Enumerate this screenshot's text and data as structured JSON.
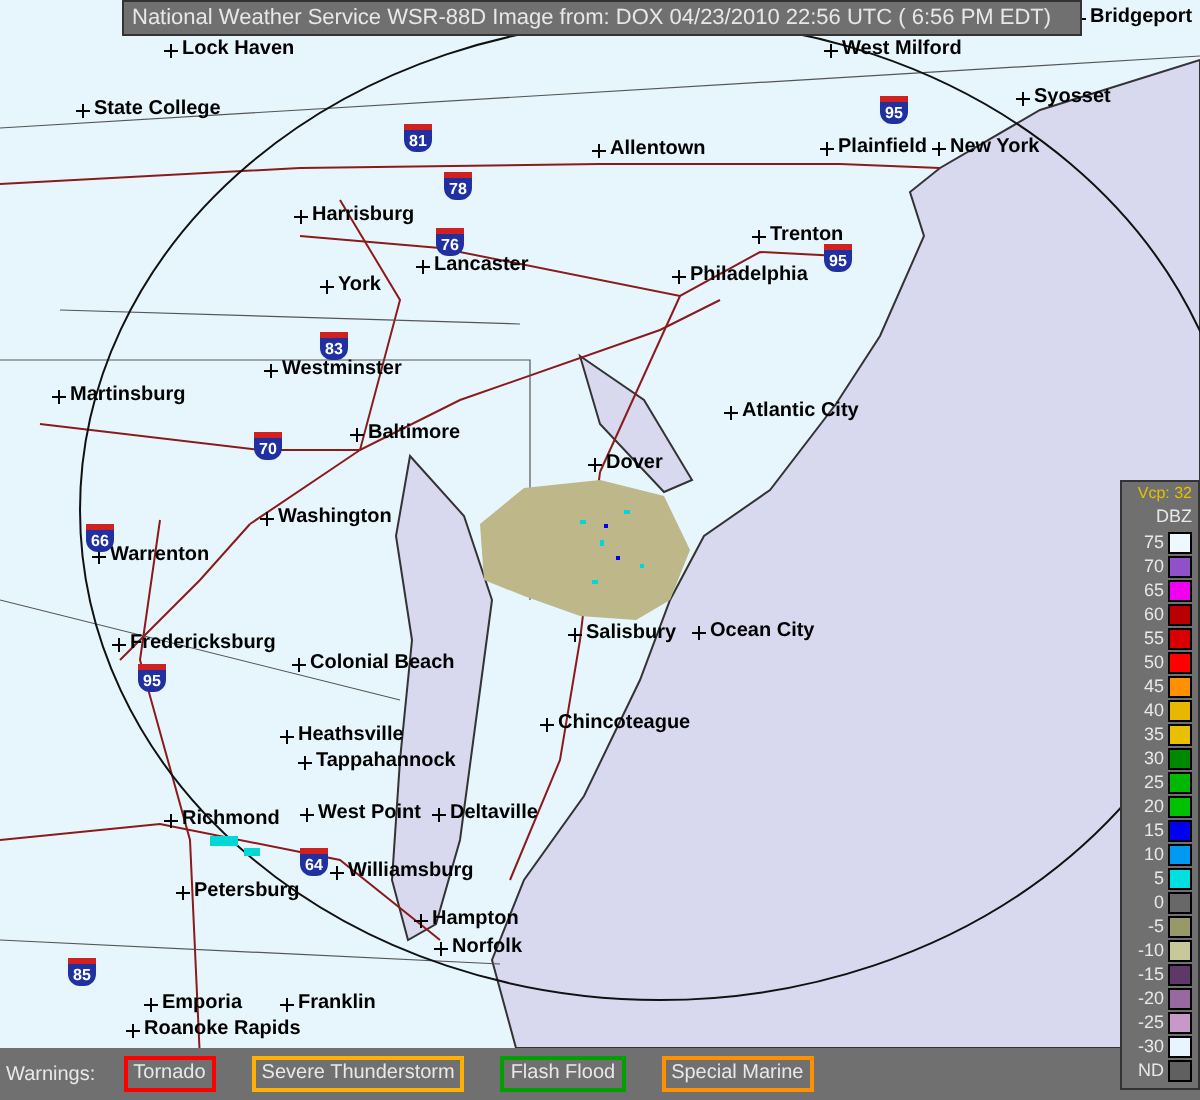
{
  "header": {
    "title": "National Weather Service WSR-88D Image from: DOX 04/23/2010 22:56 UTC ( 6:56 PM EDT)"
  },
  "map": {
    "cities": [
      {
        "name": "Lock Haven"
      },
      {
        "name": "West Milford"
      },
      {
        "name": "Bridgeport"
      },
      {
        "name": "State College"
      },
      {
        "name": "Syosset"
      },
      {
        "name": "Allentown"
      },
      {
        "name": "Plainfield"
      },
      {
        "name": "New York"
      },
      {
        "name": "Harrisburg"
      },
      {
        "name": "Trenton"
      },
      {
        "name": "York"
      },
      {
        "name": "Lancaster"
      },
      {
        "name": "Philadelphia"
      },
      {
        "name": "Martinsburg"
      },
      {
        "name": "Westminster"
      },
      {
        "name": "Atlantic City"
      },
      {
        "name": "Baltimore"
      },
      {
        "name": "Dover"
      },
      {
        "name": "Washington"
      },
      {
        "name": "Warrenton"
      },
      {
        "name": "Fredericksburg"
      },
      {
        "name": "Colonial Beach"
      },
      {
        "name": "Salisbury"
      },
      {
        "name": "Ocean City"
      },
      {
        "name": "Chincoteague"
      },
      {
        "name": "Heathsville"
      },
      {
        "name": "Tappahannock"
      },
      {
        "name": "Richmond"
      },
      {
        "name": "West Point"
      },
      {
        "name": "Deltaville"
      },
      {
        "name": "Williamsburg"
      },
      {
        "name": "Petersburg"
      },
      {
        "name": "Hampton"
      },
      {
        "name": "Norfolk"
      },
      {
        "name": "Emporia"
      },
      {
        "name": "Franklin"
      },
      {
        "name": "Roanoke Rapids"
      }
    ],
    "shields": [
      {
        "number": "81"
      },
      {
        "number": "95"
      },
      {
        "number": "78"
      },
      {
        "number": "76"
      },
      {
        "number": "95"
      },
      {
        "number": "83"
      },
      {
        "number": "70"
      },
      {
        "number": "66"
      },
      {
        "number": "95"
      },
      {
        "number": "64"
      },
      {
        "number": "85"
      }
    ]
  },
  "legend": {
    "vcp": "Vcp: 32",
    "unit": "DBZ",
    "levels": [
      {
        "label": "75",
        "color": "#eef8ff"
      },
      {
        "label": "70",
        "color": "#9050c8"
      },
      {
        "label": "65",
        "color": "#f000f0"
      },
      {
        "label": "60",
        "color": "#b80000"
      },
      {
        "label": "55",
        "color": "#d80000"
      },
      {
        "label": "50",
        "color": "#ff0000"
      },
      {
        "label": "45",
        "color": "#ff9000"
      },
      {
        "label": "40",
        "color": "#e8b800"
      },
      {
        "label": "35",
        "color": "#e8c000"
      },
      {
        "label": "30",
        "color": "#008800"
      },
      {
        "label": "25",
        "color": "#00b800"
      },
      {
        "label": "20",
        "color": "#00c000"
      },
      {
        "label": "15",
        "color": "#0000f0"
      },
      {
        "label": "10",
        "color": "#0098f0"
      },
      {
        "label": "5",
        "color": "#00e0e0"
      },
      {
        "label": "0",
        "color": "#686868"
      },
      {
        "label": "-5",
        "color": "#989868"
      },
      {
        "label": "-10",
        "color": "#c8c898"
      },
      {
        "label": "-15",
        "color": "#603868"
      },
      {
        "label": "-20",
        "color": "#9868a0"
      },
      {
        "label": "-25",
        "color": "#c898c8"
      },
      {
        "label": "-30",
        "color": "#e8f4ff"
      },
      {
        "label": "ND",
        "color": "#606060"
      }
    ]
  },
  "warnings": {
    "label": "Warnings:",
    "items": [
      {
        "label": "Tornado",
        "color": "#ff0000"
      },
      {
        "label": "Severe Thunderstorm",
        "color": "#ffb000"
      },
      {
        "label": "Flash Flood",
        "color": "#00a000"
      },
      {
        "label": "Special Marine",
        "color": "#ff9000"
      }
    ]
  }
}
